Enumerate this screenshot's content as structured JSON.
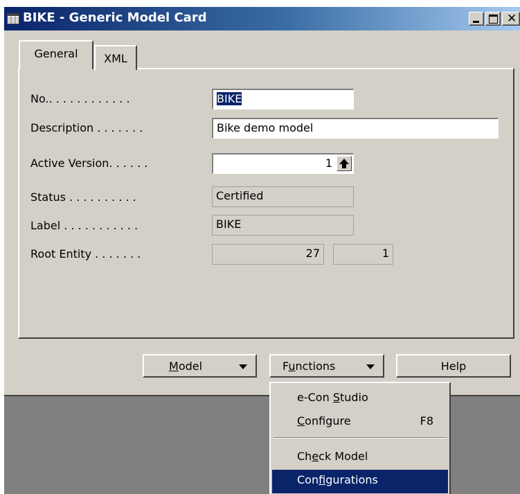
{
  "window": {
    "title": "BIKE - Generic Model Card",
    "close_glyph": "✕"
  },
  "tabs": [
    {
      "label": "General"
    },
    {
      "label": "XML"
    }
  ],
  "fields": {
    "no": {
      "label": "No.. . . . . . . . . . . .",
      "value": "BIKE"
    },
    "description": {
      "label": "Description . . . . . . .",
      "value": "Bike demo model"
    },
    "active_version": {
      "label": "Active Version. . . . . .",
      "value": "1"
    },
    "status": {
      "label": "Status . . . . . . . . . .",
      "value": "Certified"
    },
    "label": {
      "label": "Label . . . . . . . . . . .",
      "value": "BIKE"
    },
    "root_entity": {
      "label": "Root Entity . . . . . . .",
      "value1": "27",
      "value2": "1"
    }
  },
  "buttons": {
    "model": {
      "pre": "",
      "key": "M",
      "post": "odel"
    },
    "functions": {
      "pre": "F",
      "key": "u",
      "post": "nctions"
    },
    "help": "Help"
  },
  "menu": {
    "items": [
      {
        "pre": "e-Con ",
        "key": "S",
        "post": "tudio",
        "accel": ""
      },
      {
        "pre": "",
        "key": "C",
        "post": "onfigure",
        "accel": "F8"
      },
      {
        "pre": "Ch",
        "key": "e",
        "post": "ck Model",
        "accel": ""
      },
      {
        "pre": "Con",
        "key": "f",
        "post": "igurations",
        "accel": ""
      }
    ]
  },
  "colors": {
    "titlebar": "#0a246a",
    "face": "#d4d0c8",
    "selection": "#0a246a"
  }
}
